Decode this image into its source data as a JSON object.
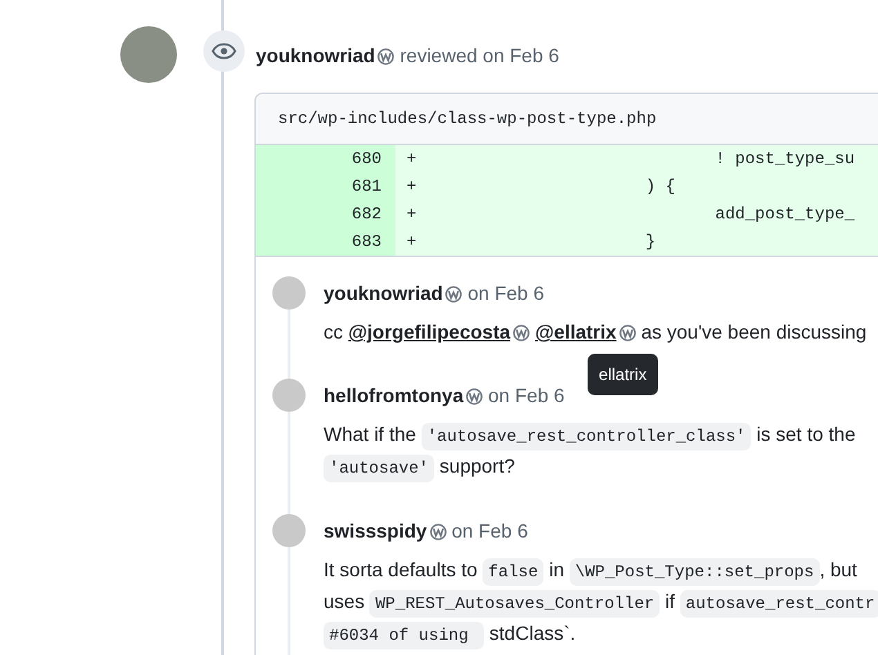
{
  "review": {
    "author": "youknowriad",
    "action": "reviewed on Feb 6",
    "file": "src/wp-includes/class-wp-post-type.php",
    "diff": [
      {
        "number": "680",
        "sign": "+",
        "code": "                              ! post_type_su"
      },
      {
        "number": "681",
        "sign": "+",
        "code": "                       ) {"
      },
      {
        "number": "682",
        "sign": "+",
        "code": "                              add_post_type_"
      },
      {
        "number": "683",
        "sign": "+",
        "code": "                       }"
      }
    ],
    "comments": [
      {
        "author": "youknowriad",
        "date": "on Feb 6",
        "lines": [
          [
            {
              "kind": "text",
              "text": "cc "
            },
            {
              "kind": "mention",
              "text": "@jorgefilipecosta"
            },
            {
              "kind": "mention",
              "text": "@ellatrix",
              "tooltip": "ellatrix"
            },
            {
              "kind": "text",
              "text": " as you've been discussing"
            }
          ]
        ]
      },
      {
        "author": "hellofromtonya",
        "date": "on Feb 6",
        "lines": [
          [
            {
              "kind": "text",
              "text": "What if the "
            },
            {
              "kind": "code",
              "text": "'autosave_rest_controller_class'"
            },
            {
              "kind": "text",
              "text": " is set to the"
            }
          ],
          [
            {
              "kind": "code",
              "text": "'autosave'"
            },
            {
              "kind": "text",
              "text": " support?"
            }
          ]
        ]
      },
      {
        "author": "swissspidy",
        "date": "on Feb 6",
        "lines": [
          [
            {
              "kind": "text",
              "text": "It sorta defaults to "
            },
            {
              "kind": "code",
              "text": "false"
            },
            {
              "kind": "text",
              "text": " in "
            },
            {
              "kind": "code",
              "text": "\\WP_Post_Type::set_props"
            },
            {
              "kind": "text",
              "text": ", but"
            }
          ],
          [
            {
              "kind": "text",
              "text": "uses "
            },
            {
              "kind": "code",
              "text": "WP_REST_Autosaves_Controller"
            },
            {
              "kind": "text",
              "text": " if "
            },
            {
              "kind": "code",
              "text": "autosave_rest_contr"
            }
          ],
          [
            {
              "kind": "code",
              "text": "#6034 of using "
            },
            {
              "kind": "text",
              "text": " stdClass`."
            }
          ]
        ]
      }
    ]
  }
}
